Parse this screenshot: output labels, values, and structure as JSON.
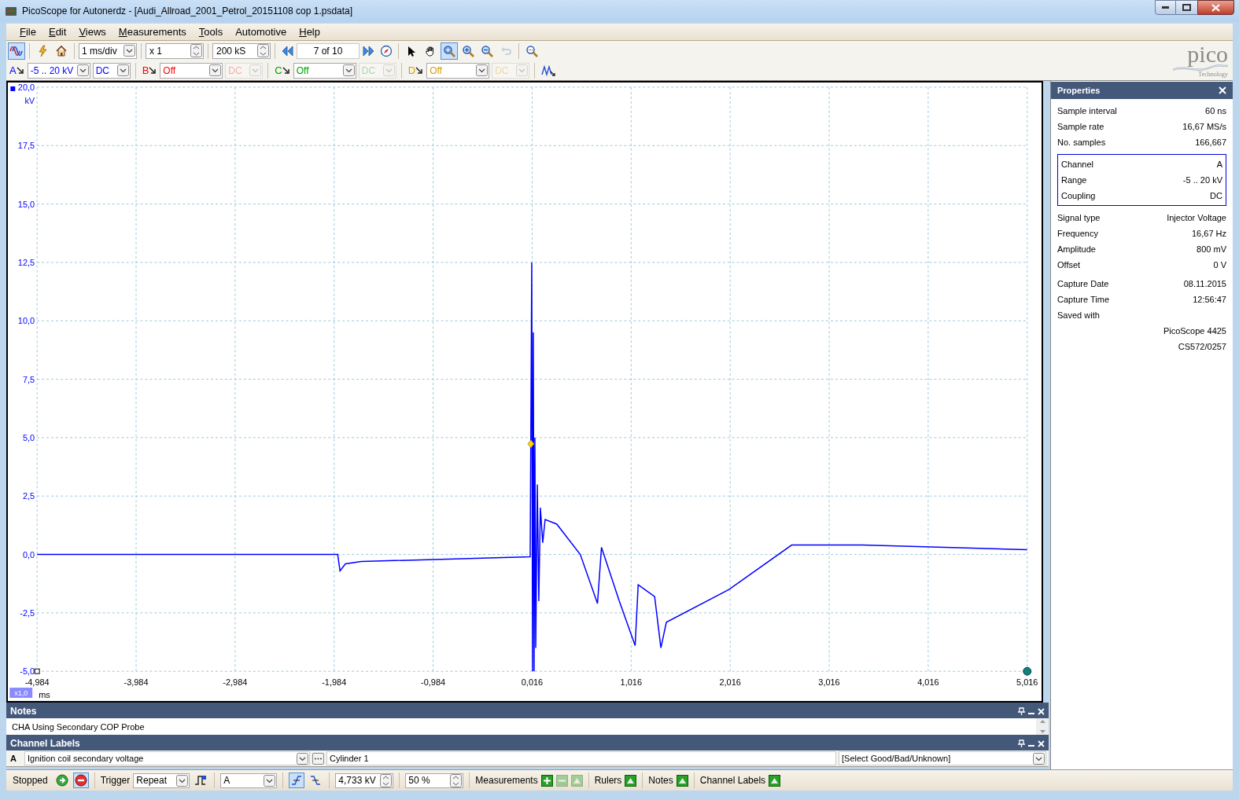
{
  "window": {
    "title": "PicoScope for Autonerdz - [Audi_Allroad_2001_Petrol_20151108 cop 1.psdata]"
  },
  "menu": [
    {
      "label": "File",
      "mnemonic": true
    },
    {
      "label": "Edit",
      "mnemonic": true
    },
    {
      "label": "Views",
      "mnemonic": true
    },
    {
      "label": "Measurements",
      "mnemonic": true
    },
    {
      "label": "Tools",
      "mnemonic": true
    },
    {
      "label": "Automotive",
      "mnemonic": false
    },
    {
      "label": "Help",
      "mnemonic": true
    }
  ],
  "logo": {
    "text": "pico",
    "subtitle": "Technology"
  },
  "toolbar": {
    "mode_selected": true,
    "timebase": "1 ms/div",
    "zoom": "x 1",
    "samples": "200 kS",
    "buffer": "7 of 10",
    "tools": [
      {
        "kind": "pointer",
        "selected": false
      },
      {
        "kind": "hand",
        "selected": false
      },
      {
        "kind": "zoom-select",
        "selected": true
      },
      {
        "kind": "zoom-in",
        "selected": false
      },
      {
        "kind": "zoom-out",
        "selected": false
      },
      {
        "kind": "undo",
        "selected": false,
        "disabled": true
      },
      {
        "kind": "overview",
        "selected": false
      }
    ]
  },
  "channels": [
    {
      "letter": "A",
      "color": "#0000ff",
      "range": "-5 .. 20 kV",
      "coupling": "DC",
      "enabled": true
    },
    {
      "letter": "B",
      "color": "#ff0000",
      "range": "Off",
      "coupling": "DC",
      "enabled": false
    },
    {
      "letter": "C",
      "color": "#00a000",
      "range": "Off",
      "coupling": "DC",
      "enabled": false
    },
    {
      "letter": "D",
      "color": "#d4a000",
      "range": "Off",
      "coupling": "DC",
      "enabled": false
    }
  ],
  "chart": {
    "zoom_badge": "x1,0",
    "chart_data": {
      "type": "line",
      "grid": true,
      "xlabel": "ms",
      "ylabel": "kV",
      "x": [
        -4.984,
        -1.948,
        -1.925,
        -1.869,
        -1.711,
        -0.004,
        0.012,
        0.02,
        0.028,
        0.036,
        0.044,
        0.052,
        0.068,
        0.083,
        0.099,
        0.123,
        0.147,
        0.265,
        0.502,
        0.676,
        0.716,
        0.897,
        1.056,
        1.087,
        1.253,
        1.316,
        1.372,
        2.004,
        2.637,
        3.348,
        5.016
      ],
      "series": [
        {
          "color": "#0000ff",
          "values": [
            0,
            0,
            -0.7,
            -0.4,
            -0.3,
            -0.1,
            12.5,
            -5,
            9.5,
            -5,
            5,
            -4,
            3,
            -2,
            2,
            0.5,
            1.5,
            1.3,
            0,
            -2.1,
            0.3,
            -2,
            -3.9,
            -1.3,
            -1.8,
            -4,
            -2.9,
            -1.5,
            0.4,
            0.4,
            0.2
          ]
        }
      ],
      "xlim": [
        -4.984,
        5.016
      ],
      "ylim": [
        -5,
        20
      ],
      "xticks": [
        {
          "value": -4.984,
          "label": "-4,984"
        },
        {
          "value": -3.984,
          "label": "-3,984"
        },
        {
          "value": -2.984,
          "label": "-2,984"
        },
        {
          "value": -1.984,
          "label": "-1,984"
        },
        {
          "value": -0.984,
          "label": "-0,984"
        },
        {
          "value": 0.016,
          "label": "0,016"
        },
        {
          "value": 1.016,
          "label": "1,016"
        },
        {
          "value": 2.016,
          "label": "2,016"
        },
        {
          "value": 3.016,
          "label": "3,016"
        },
        {
          "value": 4.016,
          "label": "4,016"
        },
        {
          "value": 5.016,
          "label": "5,016"
        }
      ],
      "yticks": [
        {
          "value": -5,
          "label": "-5,0"
        },
        {
          "value": -2.5,
          "label": "-2,5"
        },
        {
          "value": 0,
          "label": "0,0"
        },
        {
          "value": 2.5,
          "label": "2,5"
        },
        {
          "value": 5,
          "label": "5,0"
        },
        {
          "value": 7.5,
          "label": "7,5"
        },
        {
          "value": 10,
          "label": "10,0"
        },
        {
          "value": 12.5,
          "label": "12,5"
        },
        {
          "value": 15,
          "label": "15,0"
        },
        {
          "value": 17.5,
          "label": "17,5"
        },
        {
          "value": 20,
          "label": "20,0"
        }
      ]
    }
  },
  "properties": {
    "title": "Properties",
    "groups": [
      {
        "boxed": false,
        "rows": [
          {
            "label": "Sample interval",
            "value": "60 ns"
          },
          {
            "label": "Sample rate",
            "value": "16,67 MS/s"
          },
          {
            "label": "No. samples",
            "value": "166,667"
          }
        ]
      },
      {
        "boxed": true,
        "rows": [
          {
            "label": "Channel",
            "value": "A"
          },
          {
            "label": "Range",
            "value": "-5 .. 20 kV"
          },
          {
            "label": "Coupling",
            "value": "DC"
          }
        ]
      },
      {
        "boxed": false,
        "rows": [
          {
            "label": "Signal type",
            "value": "Injector Voltage"
          },
          {
            "label": "Frequency",
            "value": "16,67 Hz"
          },
          {
            "label": "Amplitude",
            "value": "800 mV"
          },
          {
            "label": "Offset",
            "value": "0 V"
          }
        ]
      },
      {
        "boxed": false,
        "rows": [
          {
            "label": "Capture Date",
            "value": "08.11.2015"
          },
          {
            "label": "Capture Time",
            "value": "12:56:47"
          },
          {
            "label": "Saved with"
          },
          {
            "value": "PicoScope 4425"
          },
          {
            "value": "CS572/0257"
          }
        ]
      }
    ]
  },
  "notes": {
    "title": "Notes",
    "text": "CHA Using Secondary COP Probe"
  },
  "channel_labels": {
    "title": "Channel Labels",
    "channel": "A",
    "label": "Ignition coil secondary voltage",
    "name": "Cylinder 1",
    "verdict": "[Select Good/Bad/Unknown]"
  },
  "status_bar": {
    "state": "Stopped",
    "running": false,
    "trigger_label": "Trigger",
    "trigger_mode": "Repeat",
    "trigger_source": "A",
    "rising_edge": true,
    "threshold": "4,733 kV",
    "pre_trigger": "50 %",
    "toggles": [
      {
        "label": "Measurements",
        "kind": "measurements"
      },
      {
        "label": "Rulers",
        "kind": "toggle"
      },
      {
        "label": "Notes",
        "kind": "toggle"
      },
      {
        "label": "Channel Labels",
        "kind": "toggle"
      }
    ]
  }
}
